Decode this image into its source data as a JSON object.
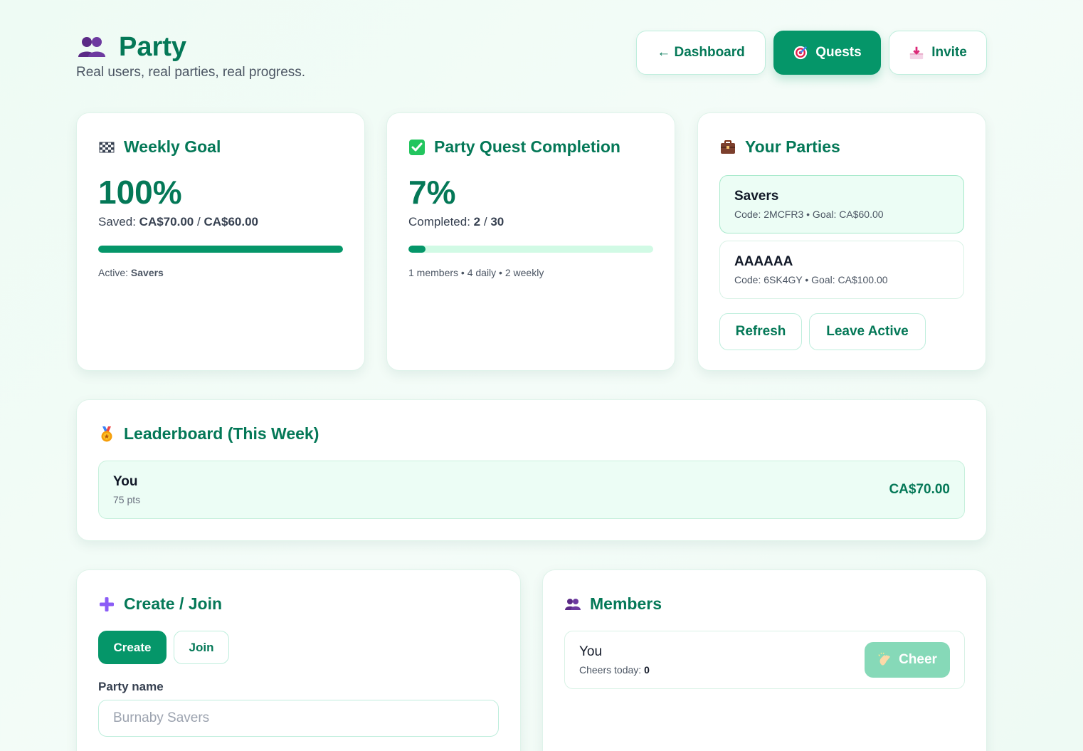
{
  "header": {
    "title": "Party",
    "subtitle": "Real users, real parties, real progress.",
    "title_icon": "people-icon"
  },
  "nav": {
    "dashboard_label": "← Dashboard",
    "quests_label": "Quests",
    "quests_icon": "target-icon",
    "invite_label": "Invite",
    "invite_icon": "inbox-tray-icon"
  },
  "weekly_goal": {
    "title": "Weekly Goal",
    "icon": "checkered-flag-icon",
    "percent": "100%",
    "saved_prefix": "Saved:",
    "saved_amount": "CA$70.00",
    "separator": "/",
    "goal_amount": "CA$60.00",
    "progress": 1.0,
    "active_prefix": "Active:",
    "active_party": "Savers"
  },
  "quest_completion": {
    "title": "Party Quest Completion",
    "icon": "check-mark-icon",
    "percent": "7%",
    "completed_prefix": "Completed:",
    "completed": "2",
    "separator": "/",
    "total": "30",
    "progress": 0.07,
    "summary": "1 members • 4 daily • 2 weekly"
  },
  "your_parties": {
    "title": "Your Parties",
    "icon": "briefcase-icon",
    "items": [
      {
        "name": "Savers",
        "meta": "Code: 2MCFR3 • Goal: CA$60.00",
        "active": true
      },
      {
        "name": "AAAAAA",
        "meta": "Code: 6SK4GY • Goal: CA$100.00",
        "active": false
      }
    ],
    "refresh_label": "Refresh",
    "leave_label": "Leave Active"
  },
  "leaderboard": {
    "title": "Leaderboard (This Week)",
    "icon": "medal-icon",
    "rows": [
      {
        "name": "You",
        "points": "75 pts",
        "amount": "CA$70.00"
      }
    ]
  },
  "create_join": {
    "title": "Create / Join",
    "icon": "plus-icon",
    "create_label": "Create",
    "join_label": "Join",
    "selected": "Create",
    "field_label": "Party name",
    "field_placeholder": "Burnaby Savers",
    "field_value": ""
  },
  "members": {
    "title": "Members",
    "icon": "people-icon",
    "rows": [
      {
        "name": "You",
        "cheers_prefix": "Cheers today:",
        "cheers": "0",
        "cheer_label": "Cheer",
        "cheer_icon": "clapping-hands-icon"
      }
    ]
  },
  "colors": {
    "brand": "#047857",
    "accent": "#059669",
    "accent_light": "#d1fae5",
    "active_bg": "#ecfdf5",
    "disabled_button": "#86d9b8"
  }
}
